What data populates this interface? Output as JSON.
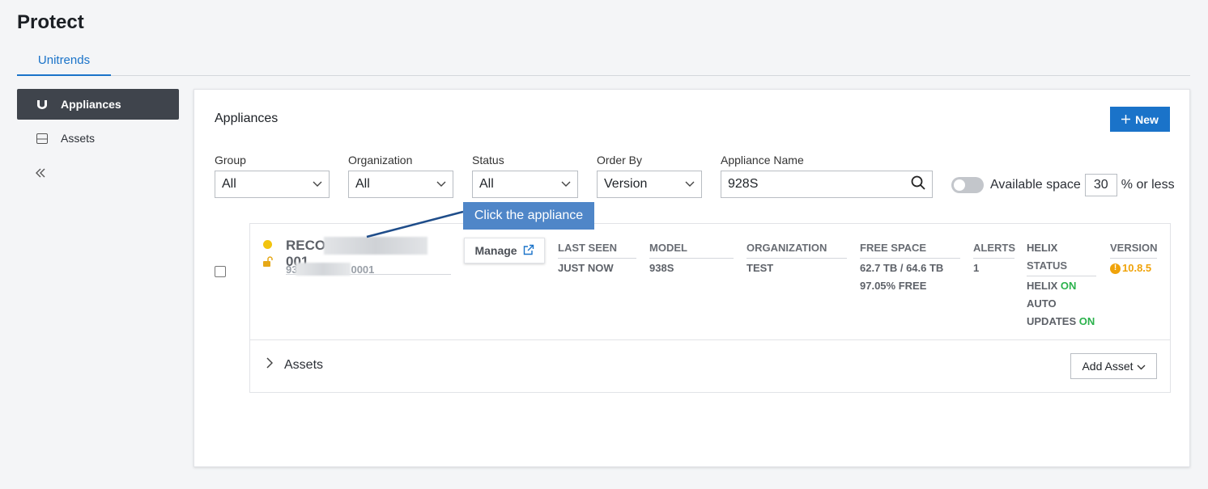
{
  "page": {
    "title": "Protect"
  },
  "tabs": [
    {
      "label": "Unitrends"
    }
  ],
  "sidebar": {
    "items": [
      {
        "label": "Appliances",
        "icon": "unitrends-logo-icon"
      },
      {
        "label": "Assets",
        "icon": "server-icon"
      }
    ],
    "collapse_icon": "double-chevron-left-icon"
  },
  "main": {
    "title": "Appliances",
    "new_button": "New",
    "filters": {
      "group": {
        "label": "Group",
        "value": "All"
      },
      "organization": {
        "label": "Organization",
        "value": "All"
      },
      "status": {
        "label": "Status",
        "value": "All"
      },
      "order_by": {
        "label": "Order By",
        "value": "Version"
      },
      "appliance_name": {
        "label": "Appliance Name",
        "value": "928S"
      }
    },
    "available_space": {
      "label": "Available space",
      "value": "30",
      "suffix": "% or less",
      "enabled": false
    },
    "appliance": {
      "name_start": "RECO",
      "name_end": "001",
      "serial_start": "93",
      "serial_end": "0001",
      "status_color": "#f2c40f",
      "manage_label": "Manage",
      "columns": {
        "last_seen": {
          "header": "LAST SEEN",
          "value": "JUST NOW"
        },
        "model": {
          "header": "MODEL",
          "value": "938S"
        },
        "organization": {
          "header": "ORGANIZATION",
          "value": "TEST"
        },
        "free_space": {
          "header": "FREE SPACE",
          "value": "62.7 TB / 64.6 TB",
          "percent": "97.05% FREE"
        },
        "alerts": {
          "header": "ALERTS",
          "value": "1"
        },
        "helix": {
          "header_line1": "HELIX",
          "header_line2": "STATUS",
          "helix_label": "HELIX",
          "helix_value": "ON",
          "auto_label_line1": "AUTO",
          "auto_label_line2": "UPDATES",
          "auto_value": "ON"
        },
        "version": {
          "header": "VERSION",
          "value": "10.8.5"
        }
      },
      "assets_label": "Assets",
      "add_asset_label": "Add Asset"
    }
  },
  "callout": {
    "text": "Click the appliance"
  },
  "colors": {
    "accent": "#1a73c9",
    "on": "#2bb24c",
    "warning": "#f0a30a",
    "callout": "#4f86c8"
  }
}
